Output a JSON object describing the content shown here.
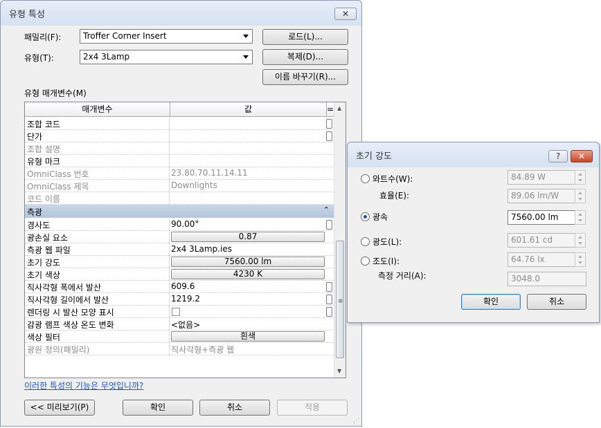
{
  "main_dialog": {
    "title": "유형 특성",
    "close": "✕",
    "family_label": "패밀리(F):",
    "family_value": "Troffer Corner Insert",
    "type_label": "유형(T):",
    "type_value": "2x4 3Lamp",
    "load_button": "로드(L)...",
    "duplicate_button": "복제(D)...",
    "rename_button": "이름 바꾸기(R)...",
    "params_label": "유형 매개변수(M)",
    "grid": {
      "col_param": "매개변수",
      "col_value": "값",
      "col_marker": "=",
      "rows_top": [
        {
          "name": "조합 코드",
          "value": "",
          "readonly": false
        },
        {
          "name": "단가",
          "value": "",
          "readonly": false
        },
        {
          "name": "조합 설명",
          "value": "",
          "readonly": true
        },
        {
          "name": "유형 마크",
          "value": "",
          "readonly": false
        },
        {
          "name": "OmniClass 번호",
          "value": "23.80.70.11.14.11",
          "readonly": true
        },
        {
          "name": "OmniClass 제목",
          "value": "Downlights",
          "readonly": true
        },
        {
          "name": "코드 이름",
          "value": "",
          "readonly": true
        }
      ],
      "group_title": "측광",
      "group_icon": "collapse-icon",
      "rows_group": [
        {
          "name": "경사도",
          "value": "90.00°",
          "kind": "text"
        },
        {
          "name": "광손실 요소",
          "value": "0.87",
          "kind": "button"
        },
        {
          "name": "측광 웹 파일",
          "value": "2x4 3Lamp.ies",
          "kind": "text"
        },
        {
          "name": "초기 강도",
          "value": "7560.00 lm",
          "kind": "button"
        },
        {
          "name": "초기 색상",
          "value": "4230 K",
          "kind": "button"
        },
        {
          "name": "직사각형 폭에서 발산",
          "value": "609.6",
          "kind": "text"
        },
        {
          "name": "직사각형 길이에서 발산",
          "value": "1219.2",
          "kind": "text"
        },
        {
          "name": "렌더링 시 발산 모양 표시",
          "value": "",
          "kind": "checkbox"
        },
        {
          "name": "감광 램프 색상 온도 변화",
          "value": "<없음>",
          "kind": "text"
        },
        {
          "name": "색상 필터",
          "value": "흰색",
          "kind": "button"
        },
        {
          "name": "광원 정의(패밀리)",
          "value": "직사각형+측광 웹",
          "kind": "readonly"
        }
      ]
    },
    "help_link": "이러한 특성의 기능은 무엇입니까?",
    "preview_button": "<< 미리보기(P)",
    "ok_button": "확인",
    "cancel_button": "취소",
    "apply_button": "적용"
  },
  "intensity_dialog": {
    "title": "초기 강도",
    "help": "?",
    "close": "✕",
    "wattage_label": "와트수(W):",
    "wattage_value": "84.89 W",
    "efficacy_label": "효율(E):",
    "efficacy_value": "89.06 lm/W",
    "flux_label": "광속",
    "flux_value": "7560.00 lm",
    "luminous_intensity_label": "광도(L):",
    "luminous_intensity_value": "601.61 cd",
    "illuminance_label": "조도(I):",
    "illuminance_value": "64.76 lx",
    "distance_label": "측정 거리(A):",
    "distance_value": "3048.0",
    "ok_button": "확인",
    "cancel_button": "취소",
    "selected": "flux"
  }
}
